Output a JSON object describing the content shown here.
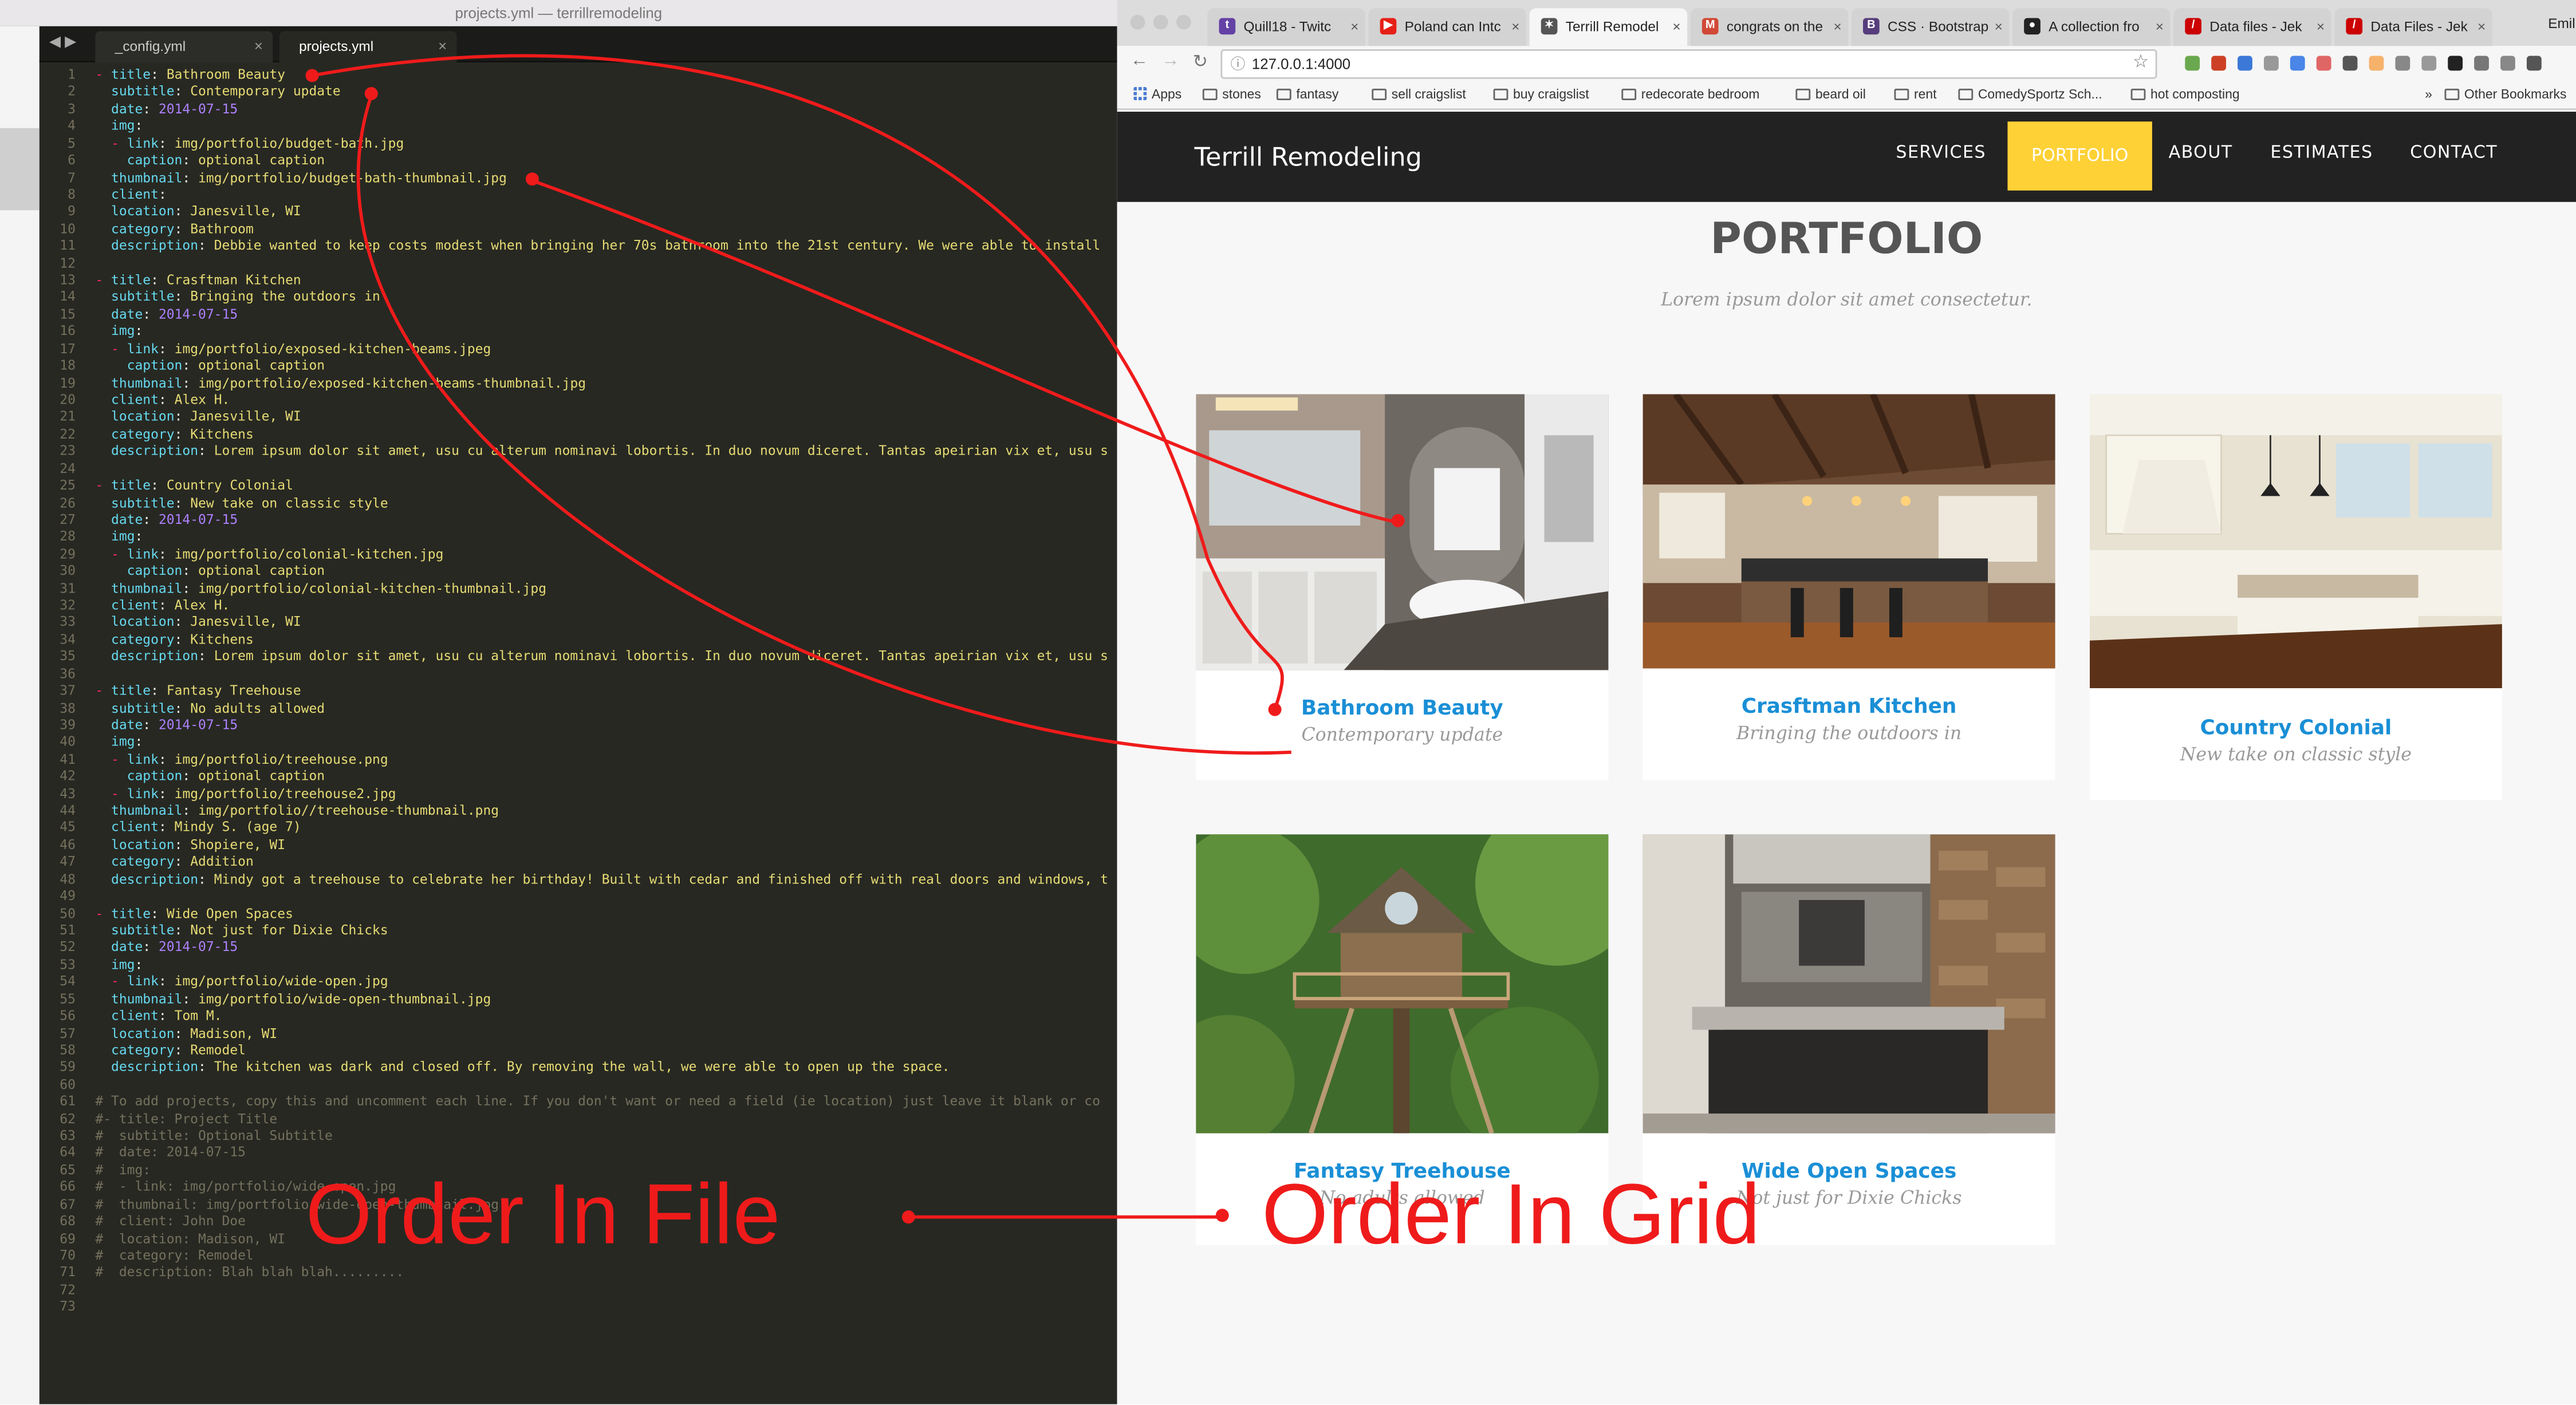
{
  "window_title": "projects.yml — terrillremodeling",
  "editor": {
    "nav_arrows": "◀ ▶",
    "tabs": [
      {
        "label": "_config.yml"
      },
      {
        "label": "projects.yml"
      }
    ],
    "lines": [
      "- title: Bathroom Beauty",
      "  subtitle: Contemporary update",
      "  date: 2014-07-15",
      "  img:",
      "  - link: img/portfolio/budget-bath.jpg",
      "    caption: optional caption",
      "  thumbnail: img/portfolio/budget-bath-thumbnail.jpg",
      "  client:",
      "  location: Janesville, WI",
      "  category: Bathroom",
      "  description: Debbie wanted to keep costs modest when bringing her 70s bathroom into the 21st century. We were able to install",
      "",
      "- title: Crasftman Kitchen",
      "  subtitle: Bringing the outdoors in",
      "  date: 2014-07-15",
      "  img:",
      "  - link: img/portfolio/exposed-kitchen-beams.jpeg",
      "    caption: optional caption",
      "  thumbnail: img/portfolio/exposed-kitchen-beams-thumbnail.jpg",
      "  client: Alex H.",
      "  location: Janesville, WI",
      "  category: Kitchens",
      "  description: Lorem ipsum dolor sit amet, usu cu alterum nominavi lobortis. In duo novum diceret. Tantas apeirian vix et, usu s",
      "",
      "- title: Country Colonial",
      "  subtitle: New take on classic style",
      "  date: 2014-07-15",
      "  img:",
      "  - link: img/portfolio/colonial-kitchen.jpg",
      "    caption: optional caption",
      "  thumbnail: img/portfolio/colonial-kitchen-thumbnail.jpg",
      "  client: Alex H.",
      "  location: Janesville, WI",
      "  category: Kitchens",
      "  description: Lorem ipsum dolor sit amet, usu cu alterum nominavi lobortis. In duo novum diceret. Tantas apeirian vix et, usu s",
      "",
      "- title: Fantasy Treehouse",
      "  subtitle: No adults allowed",
      "  date: 2014-07-15",
      "  img:",
      "  - link: img/portfolio/treehouse.png",
      "    caption: optional caption",
      "  - link: img/portfolio/treehouse2.jpg",
      "  thumbnail: img/portfolio//treehouse-thumbnail.png",
      "  client: Mindy S. (age 7)",
      "  location: Shopiere, WI",
      "  category: Addition",
      "  description: Mindy got a treehouse to celebrate her birthday! Built with cedar and finished off with real doors and windows, t",
      "",
      "- title: Wide Open Spaces",
      "  subtitle: Not just for Dixie Chicks",
      "  date: 2014-07-15",
      "  img:",
      "  - link: img/portfolio/wide-open.jpg",
      "  thumbnail: img/portfolio/wide-open-thumbnail.jpg",
      "  client: Tom M.",
      "  location: Madison, WI",
      "  category: Remodel",
      "  description: The kitchen was dark and closed off. By removing the wall, we were able to open up the space.",
      "",
      "# To add projects, copy this and uncomment each line. If you don't want or need a field (ie location) just leave it blank or co",
      "#- title: Project Title",
      "#  subtitle: Optional Subtitle",
      "#  date: 2014-07-15",
      "#  img:",
      "#  - link: img/portfolio/wide-open.jpg",
      "#  thumbnail: img/portfolio/wide-open-thumbnail.jpg",
      "#  client: John Doe",
      "#  location: Madison, WI",
      "#  category: Remodel",
      "#  description: Blah blah blah.........",
      "",
      ""
    ]
  },
  "browser": {
    "tabs": [
      {
        "label": "Quill18 - Twitc",
        "favicon": "twitch-icon",
        "color": "#6441a5",
        "glyph": "t"
      },
      {
        "label": "Poland can Intc",
        "favicon": "youtube-icon",
        "color": "#e62117",
        "glyph": "▶"
      },
      {
        "label": "Terrill Remodel",
        "favicon": "jekyll-icon",
        "color": "#555555",
        "glyph": "✶"
      },
      {
        "label": "congrats on the",
        "favicon": "gmail-icon",
        "color": "#d14836",
        "glyph": "M"
      },
      {
        "label": "CSS · Bootstrap",
        "favicon": "bootstrap-icon",
        "color": "#563d7c",
        "glyph": "B"
      },
      {
        "label": "A collection fro",
        "favicon": "github-icon",
        "color": "#222222",
        "glyph": "●"
      },
      {
        "label": "Data files - Jek",
        "favicon": "jekyll-icon",
        "color": "#cc0000",
        "glyph": "/"
      },
      {
        "label": "Data Files - Jek",
        "favicon": "jekyll-icon",
        "color": "#cc0000",
        "glyph": "/"
      }
    ],
    "profile_label": "Emil",
    "url": "127.0.0.1:4000",
    "bookmarks": [
      "Apps",
      "stones",
      "fantasy",
      "sell craigslist",
      "buy craigslist",
      "redecorate bedroom",
      "beard oil",
      "rent",
      "ComedySportz Sch...",
      "hot composting"
    ],
    "other_bookmarks": "Other Bookmarks",
    "overflow_chevron": "»"
  },
  "site": {
    "brand": "Terrill Remodeling",
    "nav": [
      "SERVICES",
      "PORTFOLIO",
      "ABOUT",
      "ESTIMATES",
      "CONTACT"
    ],
    "active_nav": "PORTFOLIO",
    "accent_color": "#fed136",
    "portfolio_title": "PORTFOLIO",
    "portfolio_subtitle": "Lorem ipsum dolor sit amet consectetur.",
    "projects": [
      {
        "title": "Bathroom Beauty",
        "subtitle": "Contemporary update"
      },
      {
        "title": "Crasftman Kitchen",
        "subtitle": "Bringing the outdoors in"
      },
      {
        "title": "Country Colonial",
        "subtitle": "New take on classic style"
      },
      {
        "title": "Fantasy Treehouse",
        "subtitle": "No adults allowed"
      },
      {
        "title": "Wide Open Spaces",
        "subtitle": "Not just for Dixie Chicks"
      }
    ]
  },
  "annotation": {
    "left_label": "Order In File",
    "right_label": "Order In Grid",
    "color": "#ef1b1b"
  }
}
